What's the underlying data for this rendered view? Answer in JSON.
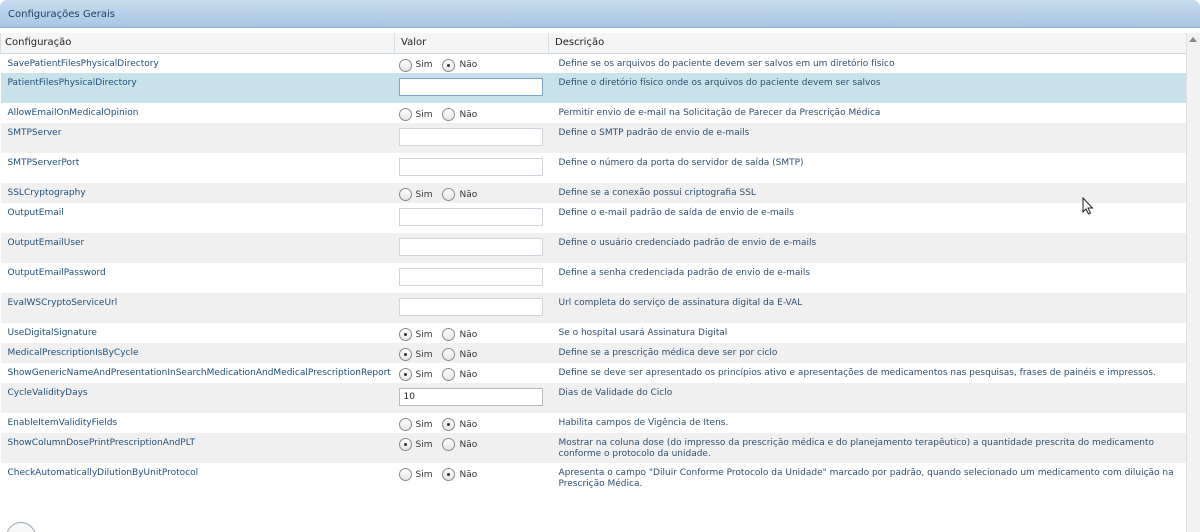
{
  "panel": {
    "title": "Configurações Gerais"
  },
  "columns": {
    "config": "Configuração",
    "value": "Valor",
    "description": "Descrição"
  },
  "radio_labels": {
    "yes": "Sim",
    "no": "Não"
  },
  "rows": [
    {
      "name": "SavePatientFilesPhysicalDirectory",
      "kind": "radio",
      "selected": "no",
      "height": 20,
      "style": "",
      "desc": "Define se os arquivos do paciente devem ser salvos em um diretório físico"
    },
    {
      "name": "PatientFilesPhysicalDirectory",
      "kind": "input",
      "input_value": "",
      "input_style": "blue",
      "height": 30,
      "style": "sel",
      "desc": "Define o diretório físico onde os arquivos do paciente devem ser salvos"
    },
    {
      "name": "AllowEmailOnMedicalOpinion",
      "kind": "radio",
      "selected": "",
      "height": 20,
      "style": "",
      "desc": "Permitir envio de e-mail na Solicitação de Parecer da Prescrição Médica"
    },
    {
      "name": "SMTPServer",
      "kind": "input",
      "input_value": "",
      "input_style": "",
      "height": 30,
      "style": "stripe",
      "desc": "Define o SMTP padrão de envio de e-mails"
    },
    {
      "name": "SMTPServerPort",
      "kind": "input",
      "input_value": "",
      "input_style": "",
      "height": 30,
      "style": "",
      "desc": "Define o número da porta do servidor de saída (SMTP)"
    },
    {
      "name": "SSLCryptography",
      "kind": "radio",
      "selected": "",
      "height": 20,
      "style": "stripe",
      "desc": "Define se a conexão possui criptografia SSL"
    },
    {
      "name": "OutputEmail",
      "kind": "input",
      "input_value": "",
      "input_style": "",
      "height": 30,
      "style": "",
      "desc": "Define o e-mail padrão de saída de envio de e-mails"
    },
    {
      "name": "OutputEmailUser",
      "kind": "input",
      "input_value": "",
      "input_style": "",
      "height": 30,
      "style": "stripe",
      "desc": "Define o usuário credenciado padrão de envio de e-mails"
    },
    {
      "name": "OutputEmailPassword",
      "kind": "input",
      "input_value": "",
      "input_style": "",
      "height": 30,
      "style": "",
      "desc": "Define a senha credenciada padrão de envio de e-mails"
    },
    {
      "name": "EvalWSCryptoServiceUrl",
      "kind": "input",
      "input_value": "",
      "input_style": "",
      "height": 30,
      "style": "stripe",
      "desc": "Url completa do serviço de assinatura digital da E-VAL"
    },
    {
      "name": "UseDigitalSignature",
      "kind": "radio",
      "selected": "yes",
      "height": 20,
      "style": "",
      "desc": "Se o hospital usará Assinatura Digital"
    },
    {
      "name": "MedicalPrescriptionIsByCycle",
      "kind": "radio",
      "selected": "yes",
      "height": 20,
      "style": "stripe",
      "desc": "Define se a prescrição médica deve ser por ciclo"
    },
    {
      "name": "ShowGenericNameAndPresentationInSearchMedicationAndMedicalPrescriptionReport",
      "kind": "radio",
      "selected": "yes",
      "height": 20,
      "style": "",
      "desc": "Define se deve ser apresentado os princípios ativo e apresentações de medicamentos nas pesquisas, frases de painéis e impressos."
    },
    {
      "name": "CycleValidityDays",
      "kind": "input",
      "input_value": "10",
      "input_style": "grey",
      "height": 30,
      "style": "stripe",
      "desc": "Dias de Validade do Ciclo"
    },
    {
      "name": "EnableItemValidityFields",
      "kind": "radio",
      "selected": "no",
      "height": 20,
      "style": "",
      "desc": "Habilita campos de Vigência de Itens."
    },
    {
      "name": "ShowColumnDosePrintPrescriptionAndPLT",
      "kind": "radio",
      "selected": "yes",
      "height": 30,
      "style": "stripe",
      "desc": "Mostrar na coluna dose (do impresso da prescrição médica e do planejamento terapêutico) a quantidade prescrita do medicamento conforme o protocolo da unidade."
    },
    {
      "name": "CheckAutomaticallyDilutionByUnitProtocol",
      "kind": "radio",
      "selected": "no",
      "height": 30,
      "style": "",
      "desc": "Apresenta o campo \"Diluir Conforme Protocolo da Unidade\" marcado por padrão, quando selecionado um medicamento com diluição na Prescrição Médica."
    }
  ]
}
